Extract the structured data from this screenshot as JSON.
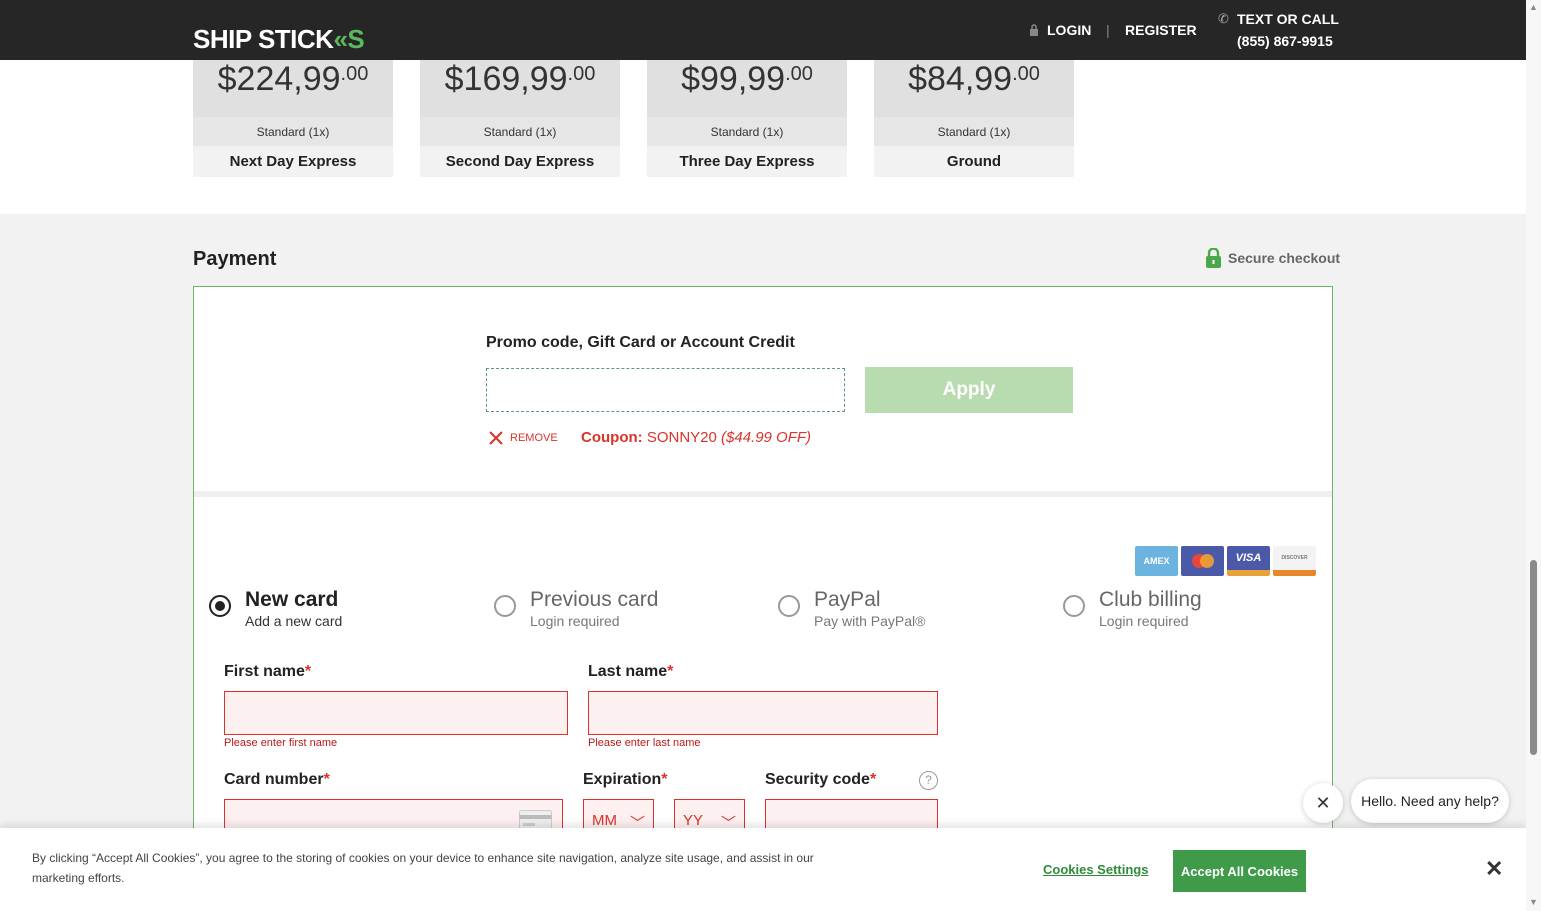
{
  "header": {
    "logo_text": "SHIP STICK",
    "logo_chevrons": "«S",
    "login": "LOGIN",
    "separator": "|",
    "register": "REGISTER",
    "text_or_call": "TEXT OR CALL",
    "phone": "(855) 867-9915"
  },
  "shipping_options": [
    {
      "price": "$224,99",
      "cents": ".00",
      "standard": "Standard (1x)",
      "name": "Next Day Express"
    },
    {
      "price": "$169,99",
      "cents": ".00",
      "standard": "Standard (1x)",
      "name": "Second Day Express"
    },
    {
      "price": "$99,99",
      "cents": ".00",
      "standard": "Standard (1x)",
      "name": "Three Day Express"
    },
    {
      "price": "$84,99",
      "cents": ".00",
      "standard": "Standard (1x)",
      "name": "Ground"
    }
  ],
  "payment": {
    "title": "Payment",
    "secure_checkout": "Secure checkout",
    "promo_label": "Promo code, Gift Card or Account Credit",
    "promo_value": "",
    "apply_label": "Apply",
    "remove_label": "REMOVE",
    "coupon_label": "Coupon:",
    "coupon_code": "SONNY20",
    "coupon_discount": "($44.99 OFF)",
    "card_logos": [
      "AMEX",
      "MC",
      "VISA",
      "DISCOVER"
    ],
    "options": [
      {
        "title": "New card",
        "sub": "Add a new card",
        "selected": true
      },
      {
        "title": "Previous card",
        "sub": "Login required",
        "selected": false
      },
      {
        "title": "PayPal",
        "sub": "Pay with PayPal®",
        "selected": false
      },
      {
        "title": "Club billing",
        "sub": "Login required",
        "selected": false
      }
    ],
    "first_name_label": "First name",
    "last_name_label": "Last name",
    "first_name_error": "Please enter first name",
    "last_name_error": "Please enter last name",
    "card_number_label": "Card number",
    "expiration_label": "Expiration",
    "security_code_label": "Security code",
    "required_mark": "*",
    "month_placeholder": "MM",
    "year_placeholder": "YY",
    "help_icon": "?"
  },
  "chat": {
    "close_glyph": "✕",
    "message": "Hello. Need any help?"
  },
  "cookie": {
    "text": "By clicking “Accept All Cookies”, you agree to the storing of cookies on your device to enhance site navigation, analyze site usage, and assist in our marketing efforts.",
    "settings_label": "Cookies Settings",
    "accept_label": "Accept All Cookies",
    "close_glyph": "✕"
  },
  "colors": {
    "header_bg": "#262626",
    "brand_green": "#3f9a4a",
    "error_red": "#d9332b",
    "apply_disabled": "#b8dcb0"
  }
}
